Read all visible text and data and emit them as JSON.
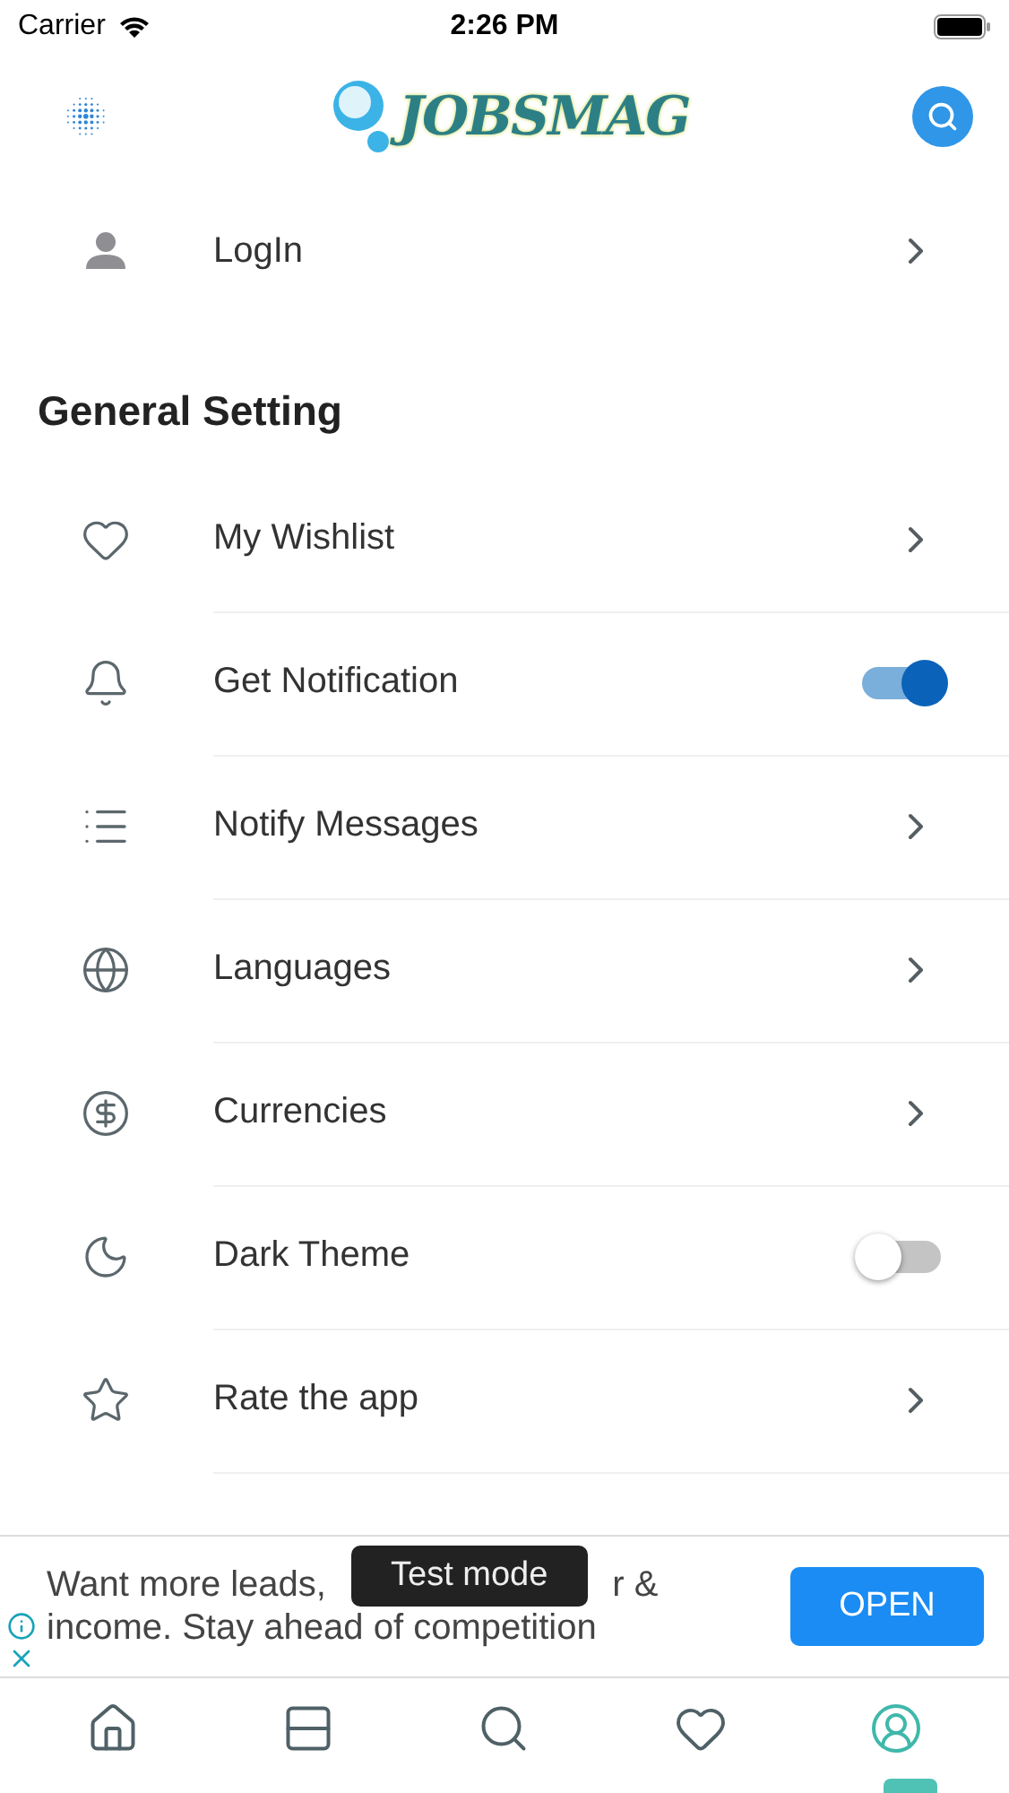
{
  "status_bar": {
    "carrier": "Carrier",
    "time": "2:26 PM"
  },
  "header": {
    "logo_text": "JOBSMAG"
  },
  "login": {
    "label": "LogIn"
  },
  "section_title": "General Setting",
  "settings": [
    {
      "label": "My Wishlist",
      "kind": "link"
    },
    {
      "label": "Get Notification",
      "kind": "toggle",
      "on": true
    },
    {
      "label": "Notify Messages",
      "kind": "link"
    },
    {
      "label": "Languages",
      "kind": "link"
    },
    {
      "label": "Currencies",
      "kind": "link"
    },
    {
      "label": "Dark Theme",
      "kind": "toggle",
      "on": false
    },
    {
      "label": "Rate the app",
      "kind": "link"
    }
  ],
  "ad": {
    "line_1_start": "Want more leads,",
    "line_1_end": "r &",
    "line_2": "income. Stay ahead of competition",
    "button": "OPEN",
    "toast": "Test mode"
  },
  "tab_bar": [
    {
      "selected": false
    },
    {
      "selected": false
    },
    {
      "selected": false
    },
    {
      "selected": false
    },
    {
      "selected": true
    }
  ]
}
